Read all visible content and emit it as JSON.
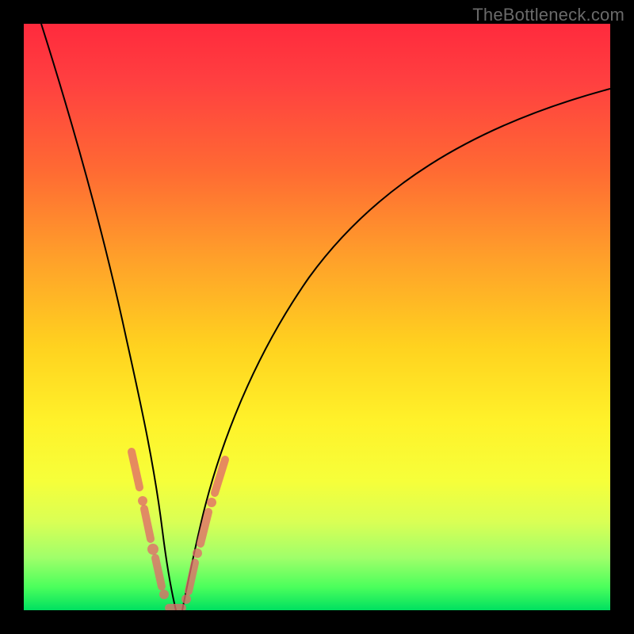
{
  "watermark": "TheBottleneck.com",
  "colors": {
    "frame": "#000000",
    "curve": "#000000",
    "marker": "#e06a6a",
    "gradient_top": "#ff2a3d",
    "gradient_mid": "#fff22a",
    "gradient_bottom": "#00e060"
  },
  "chart_data": {
    "type": "line",
    "title": "",
    "xlabel": "",
    "ylabel": "",
    "xlim": [
      0,
      100
    ],
    "ylim": [
      0,
      100
    ],
    "grid": false,
    "legend": false,
    "series": [
      {
        "name": "left-branch",
        "x": [
          3,
          5,
          8,
          11,
          14,
          16,
          18,
          20,
          21.5,
          23,
          24,
          25
        ],
        "values": [
          100,
          88,
          72,
          57,
          44,
          35,
          27,
          19,
          13,
          8,
          4,
          0
        ]
      },
      {
        "name": "right-branch",
        "x": [
          27,
          28.5,
          30,
          32,
          35,
          40,
          46,
          54,
          63,
          73,
          84,
          96,
          100
        ],
        "values": [
          0,
          5,
          10,
          17,
          27,
          40,
          52,
          63,
          72,
          79,
          84,
          88,
          89
        ]
      }
    ],
    "marker_clusters": [
      {
        "name": "left-cluster",
        "points": [
          {
            "x": 18.0,
            "y": 27
          },
          {
            "x": 19.2,
            "y": 22
          },
          {
            "x": 20.5,
            "y": 17
          },
          {
            "x": 21.0,
            "y": 15
          },
          {
            "x": 22.0,
            "y": 11
          },
          {
            "x": 23.0,
            "y": 7
          },
          {
            "x": 24.0,
            "y": 4
          },
          {
            "x": 25.0,
            "y": 1
          }
        ]
      },
      {
        "name": "right-cluster",
        "points": [
          {
            "x": 27.0,
            "y": 1
          },
          {
            "x": 28.0,
            "y": 4
          },
          {
            "x": 29.0,
            "y": 8
          },
          {
            "x": 30.0,
            "y": 12
          },
          {
            "x": 31.5,
            "y": 17
          },
          {
            "x": 33.0,
            "y": 22
          },
          {
            "x": 34.5,
            "y": 26
          }
        ]
      },
      {
        "name": "bottom-cluster",
        "points": [
          {
            "x": 25.5,
            "y": 0.5
          },
          {
            "x": 26.5,
            "y": 0.5
          }
        ]
      }
    ],
    "notes": "Axes are unlabeled in the source image; x and y scaled 0–100. Values estimated from pixel positions. The curve is a steep V with minimum near x≈26, y≈0. Salmon markers cluster along both branches near the bottom."
  }
}
